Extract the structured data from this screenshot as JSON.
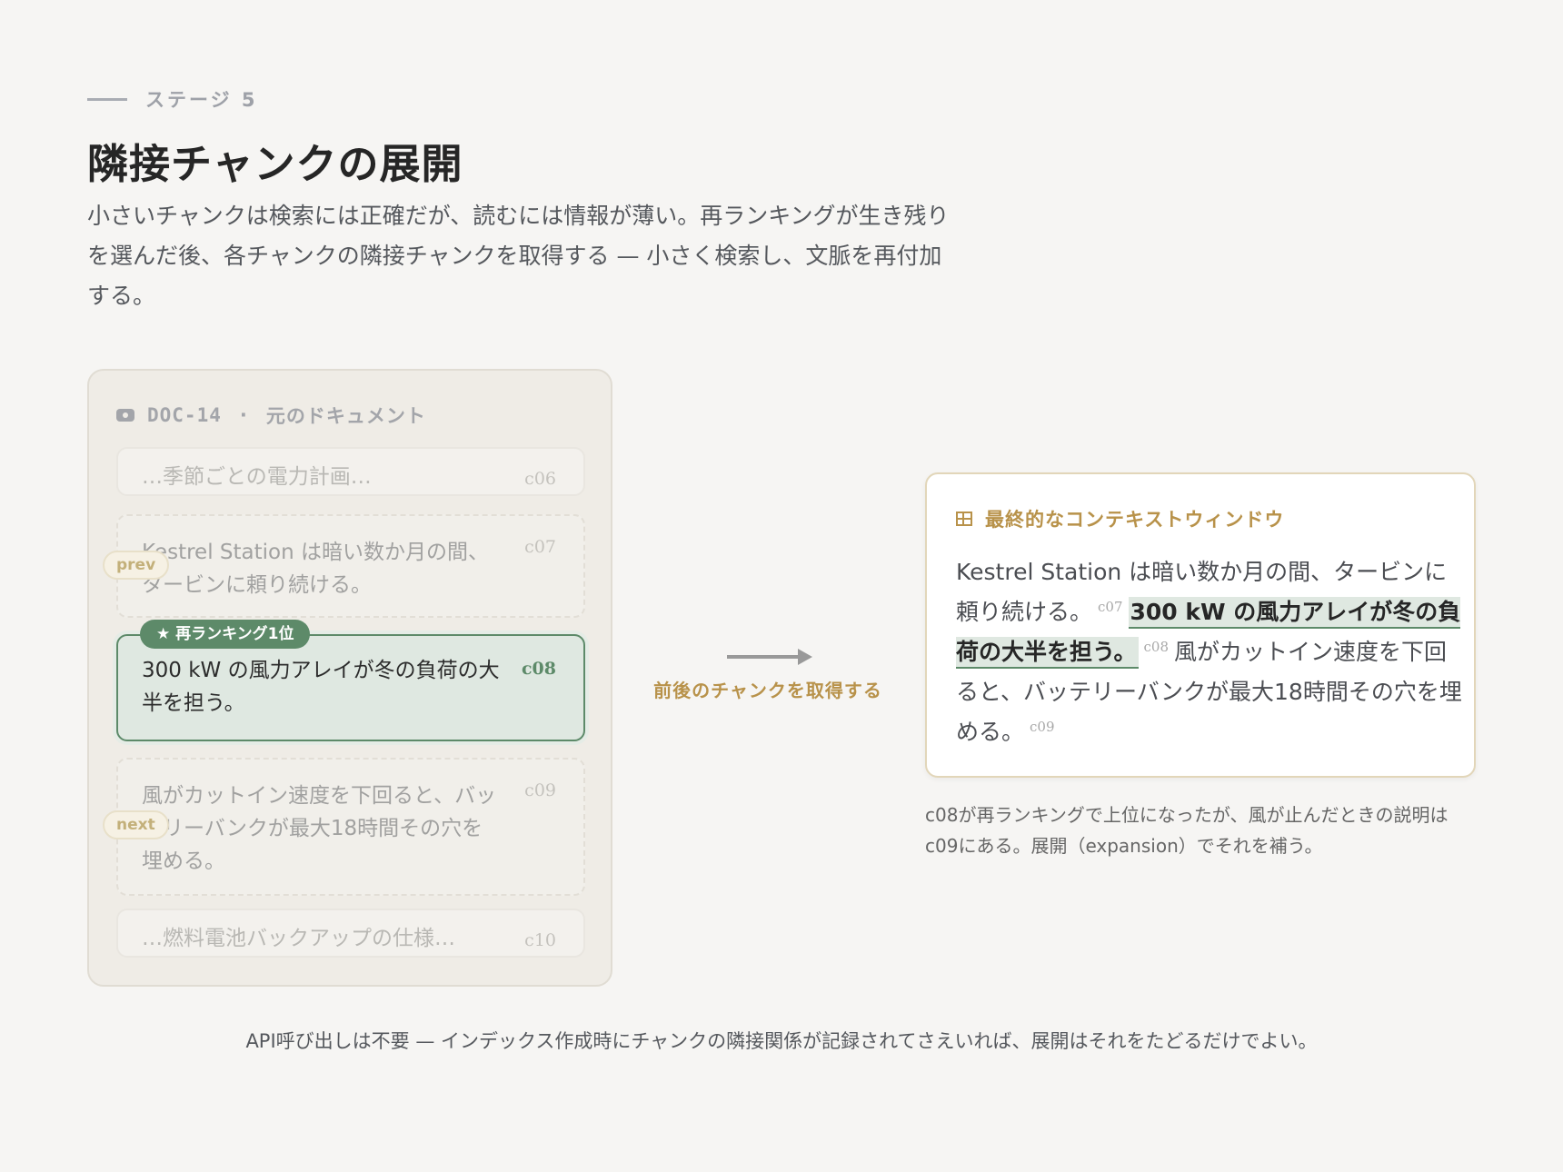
{
  "header": {
    "eyebrow": "ステージ 5",
    "title": "隣接チャンクの展開",
    "intro": "小さいチャンクは検索には正確だが、読むには情報が薄い。再ランキングが生き残りを選んだ後、各チャンクの隣接チャンクを取得する — 小さく検索し、文脈を再付加する。"
  },
  "document": {
    "id": "DOC-14",
    "separator": "·",
    "label": "元のドキュメント",
    "chunks": [
      {
        "id": "c06",
        "text": "…季節ごとの電力計画…",
        "role": "outside"
      },
      {
        "id": "c07",
        "text": "Kestrel Station は暗い数か月の間、タービンに頼り続ける。",
        "role": "prev",
        "tag": "prev"
      },
      {
        "id": "c08",
        "text": "300 kW の風力アレイが冬の負荷の大半を担う。",
        "role": "selected",
        "badge": "★ 再ランキング1位"
      },
      {
        "id": "c09",
        "text": "風がカットイン速度を下回ると、バッテリーバンクが最大18時間その穴を埋める。",
        "role": "next",
        "tag": "next"
      },
      {
        "id": "c10",
        "text": "…燃料電池バックアップの仕様…",
        "role": "outside"
      }
    ]
  },
  "arrow": {
    "label": "前後のチャンクを取得する"
  },
  "context_window": {
    "title": "最終的なコンテキストウィンドウ",
    "icon": "grid-icon",
    "segments": [
      {
        "id": "c07",
        "text": "Kestrel Station は暗い数か月の間、タービンに頼り続ける。"
      },
      {
        "id": "c08",
        "text": "300 kW の風力アレイが冬の負荷の大半を担う。"
      },
      {
        "id": "c09",
        "text": "風がカットイン速度を下回ると、バッテリーバンクが最大18時間その穴を埋める。"
      }
    ],
    "note": "c08が再ランキングで上位になったが、風が止んだときの説明はc09にある。展開（expansion）でそれを補う。"
  },
  "footer": {
    "text": "API呼び出しは不要 — インデックス作成時にチャンクの隣接関係が記録されてさえいれば、展開はそれをたどるだけでよい。"
  },
  "colors": {
    "background": "#f6f5f3",
    "accent_green": "#5d8a69",
    "accent_gold": "#b8924a",
    "selected_fill": "#dfe8e1"
  }
}
